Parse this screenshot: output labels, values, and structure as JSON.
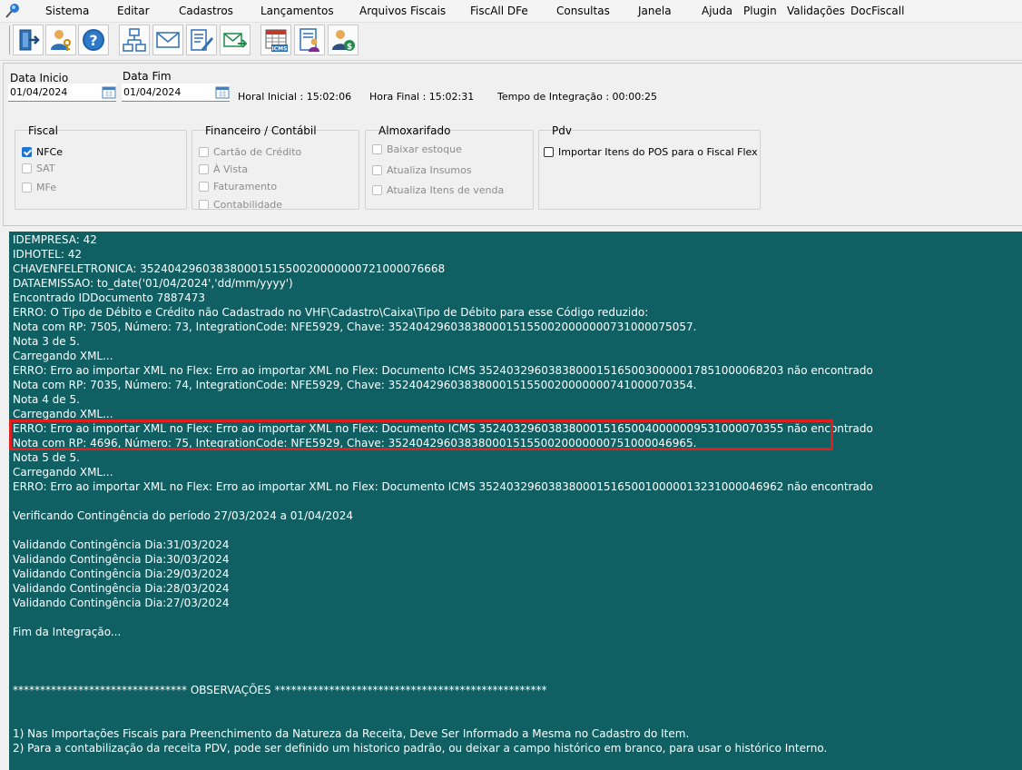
{
  "menu": [
    "Sistema",
    "Editar",
    "Cadastros",
    "Lançamentos",
    "Arquivos Fiscais",
    "FiscAll DFe",
    "Consultas",
    "Janela",
    "Ajuda",
    "Plugin",
    "Validações",
    "DocFiscall"
  ],
  "toolbar": {
    "icons": [
      "exit-door-icon",
      "user-key-icon",
      "help-icon",
      "network-icon",
      "mail-icon",
      "edit-form-icon",
      "send-mail-icon",
      "icms-table-icon",
      "document-user-icon",
      "user-money-icon"
    ]
  },
  "filters": {
    "data_inicio_label": "Data Inicio",
    "data_inicio_value": "01/04/2024",
    "data_fim_label": "Data Fim",
    "data_fim_value": "01/04/2024",
    "hora_inicial": "Horal Inicial : 15:02:06",
    "hora_final": "Hora Final : 15:02:31",
    "tempo": "Tempo de Integração :  00:00:25"
  },
  "groups": {
    "fiscal": {
      "title": "Fiscal",
      "items": [
        {
          "label": "NFCe",
          "checked": true,
          "enabled": true
        },
        {
          "label": "SAT",
          "checked": false,
          "enabled": false
        },
        {
          "label": "MFe",
          "checked": false,
          "enabled": false
        }
      ]
    },
    "financeiro": {
      "title": "Financeiro / Contábil",
      "items": [
        {
          "label": "Cartão de Crédito",
          "checked": false,
          "enabled": false
        },
        {
          "label": "À Vista",
          "checked": false,
          "enabled": false
        },
        {
          "label": "Faturamento",
          "checked": false,
          "enabled": false
        },
        {
          "label": "Contabilidade",
          "checked": false,
          "enabled": false
        }
      ]
    },
    "almoxarifado": {
      "title": "Almoxarifado",
      "items": [
        {
          "label": "Baixar estoque",
          "checked": false,
          "enabled": false
        },
        {
          "label": "Atualiza Insumos",
          "checked": false,
          "enabled": false
        },
        {
          "label": "Atualiza Itens de venda",
          "checked": false,
          "enabled": false
        }
      ]
    },
    "pdv": {
      "title": "Pdv",
      "items": [
        {
          "label": "Importar Itens do POS para o Fiscal Flex",
          "checked": false,
          "enabled": true
        }
      ]
    }
  },
  "log_lines": [
    "IDEMPRESA: 42",
    "IDHOTEL: 42",
    "CHAVENFELETRONICA: 35240429603838000151550020000000721000076668",
    "DATAEMISSAO: to_date('01/04/2024','dd/mm/yyyy')",
    "Encontrado IDDocumento 7887473",
    "ERRO: O Tipo de Débito e Crédito não Cadastrado no VHF\\Cadastro\\Caixa\\Tipo de Débito para esse Código reduzido:",
    "Nota com RP: 7505, Número: 73, IntegrationCode: NFE5929, Chave: 35240429603838000151550020000000731000075057.",
    "Nota 3 de 5.",
    "Carregando XML...",
    "ERRO: Erro ao importar XML no Flex: Erro ao importar XML no Flex: Documento ICMS 35240329603838000151650030000017851000068203 não encontrado",
    "Nota com RP: 7035, Número: 74, IntegrationCode: NFE5929, Chave: 35240429603838000151550020000000741000070354.",
    "Nota 4 de 5.",
    "Carregando XML...",
    "ERRO: Erro ao importar XML no Flex: Erro ao importar XML no Flex: Documento ICMS 35240329603838000151650040000009531000070355 não encontrado",
    "Nota com RP: 4696, Número: 75, IntegrationCode: NFE5929, Chave: 35240429603838000151550020000000751000046965.",
    "Nota 5 de 5.",
    "Carregando XML...",
    "ERRO: Erro ao importar XML no Flex: Erro ao importar XML no Flex: Documento ICMS 35240329603838000151650010000013231000046962 não encontrado",
    "",
    "Verificando Contingência do período 27/03/2024 a 01/04/2024",
    "",
    "Validando Contingência Dia:31/03/2024",
    "Validando Contingência Dia:30/03/2024",
    "Validando Contingência Dia:29/03/2024",
    "Validando Contingência Dia:28/03/2024",
    "Validando Contingência Dia:27/03/2024",
    "",
    "Fim da Integração...",
    "",
    "",
    "",
    "********************************  OBSERVAÇÕES   **************************************************",
    "",
    "",
    "1) Nas Importações Fiscais para Preenchimento da Natureza da Receita, Deve Ser Informado a Mesma no Cadastro do Item.",
    "2) Para a contabilização da receita PDV, pode ser definido um historico padrão, ou deixar a campo histórico em branco, para usar o histórico Interno."
  ],
  "colors": {
    "log_background": "#0f5f63",
    "highlight_border": "#e01e1e",
    "checkbox_checked": "#1e73d6"
  }
}
